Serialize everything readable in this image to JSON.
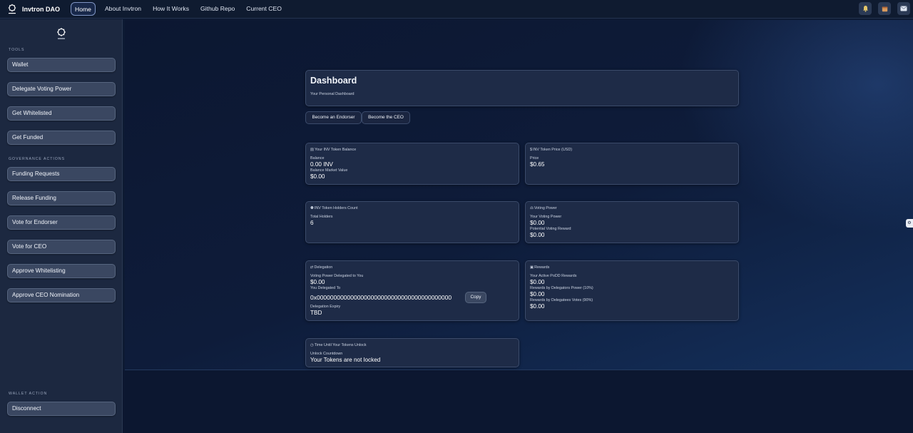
{
  "header": {
    "brand_name": "Invtron DAO",
    "nav": [
      {
        "label": "Home",
        "active": true
      },
      {
        "label": "About Invtron"
      },
      {
        "label": "How It Works"
      },
      {
        "label": "Github Repo"
      },
      {
        "label": "Current CEO"
      }
    ],
    "icons": [
      "bell-icon",
      "calendar-icon",
      "mail-icon"
    ]
  },
  "sidebar": {
    "tools_title": "TOOLS",
    "tools": [
      "Wallet",
      "Delegate Voting Power",
      "Get Whitelisted",
      "Get Funded"
    ],
    "governance_title": "GOVERNANCE ACTIONS",
    "governance": [
      "Funding Requests",
      "Release Funding",
      "Vote for Endorser",
      "Vote for CEO",
      "Approve Whitelisting",
      "Approve CEO Nomination"
    ],
    "wallet_title": "WALLET ACTION",
    "wallet_action": "Disconnect"
  },
  "dashboard": {
    "title": "Dashboard",
    "subtitle": "Your Personal Dashboard",
    "tabs": [
      "Become an Endorser",
      "Become the CEO"
    ]
  },
  "cards": {
    "balance": {
      "title": "Your INV Token Balance",
      "icon": "wallet-icon",
      "balance_label": "Balance",
      "balance_value": "0.00 INV",
      "market_label": "Balance Market Value",
      "market_value": "$0.00"
    },
    "price": {
      "title": "INV Token Price (USD)",
      "icon": "dollar-icon",
      "price_label": "Price",
      "price_value": "$0.65"
    },
    "holders": {
      "title": "INV Token Holders Count",
      "icon": "users-icon",
      "total_label": "Total Holders",
      "total_value": "6"
    },
    "voting": {
      "title": "Voting Power",
      "icon": "vote-icon",
      "power_label": "Your Voting Power",
      "power_value": "$0.00",
      "reward_label": "Potential Voting Reward",
      "reward_value": "$0.00"
    },
    "delegation": {
      "title": "Delegation",
      "icon": "swap-icon",
      "delegated_to_you_label": "Voting Power Delegated to You",
      "delegated_to_you_value": "$0.00",
      "you_delegated_label": "You Delegated To",
      "you_delegated_value": "0x0000000000000000000000000000000000000000",
      "copy_label": "Copy",
      "expiry_label": "Delegation Expiry",
      "expiry_value": "TBD"
    },
    "rewards": {
      "title": "Rewards",
      "icon": "gift-icon",
      "active_label": "Your Active PoDD Rewards",
      "active_value": "$0.00",
      "delegators_label": "Rewards by Delegators Power (10%)",
      "delegators_value": "$0.00",
      "delegatees_label": "Rewards by Delegatees Votes (90%)",
      "delegatees_value": "$0.00"
    },
    "unlock": {
      "title": "Time Until Your Tokens Unlock",
      "icon": "clock-icon",
      "countdown_label": "Unlock Countdown",
      "countdown_value": "Your Tokens are not locked"
    }
  },
  "colors": {
    "page_bg": "#0d1a33",
    "sidebar_bg": "#1c2840",
    "card_bg": "#1e2b47",
    "button_bg": "#3a4761"
  }
}
